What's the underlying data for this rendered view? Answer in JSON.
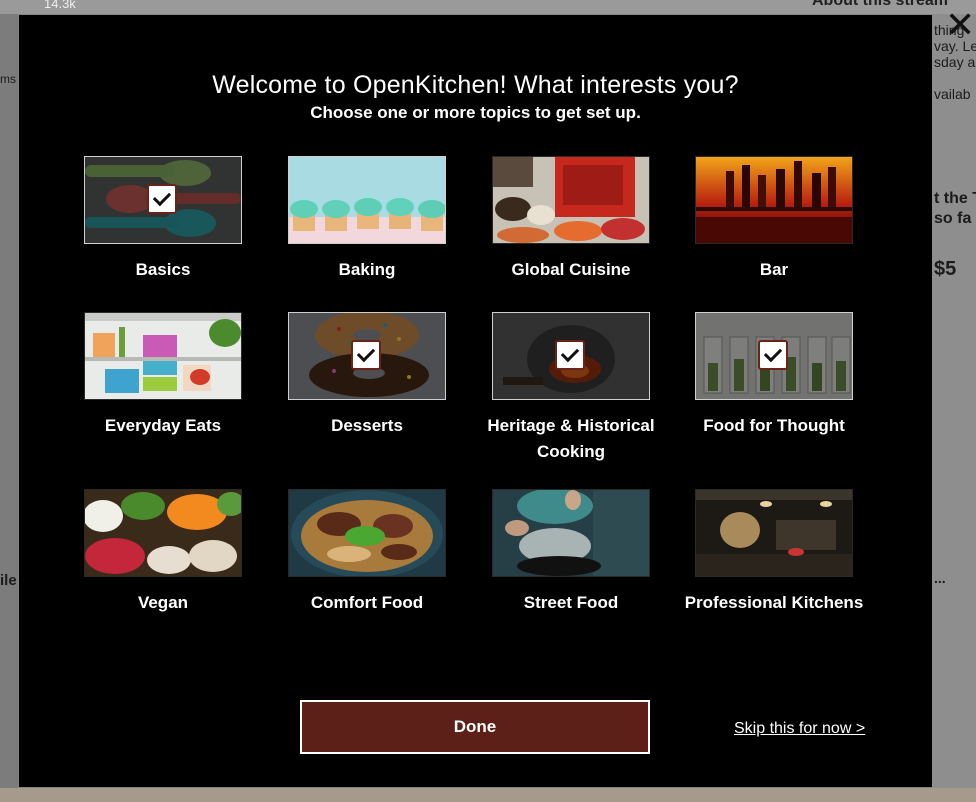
{
  "background": {
    "count": "14.3k",
    "heading": "About this stream",
    "lines": [
      "thing",
      "vay. Le",
      "sday a",
      "vailab",
      "t the T",
      "so fa",
      "$5",
      "ms",
      "ile",
      "..."
    ]
  },
  "close_icon": "close-icon",
  "modal": {
    "title": "Welcome to OpenKitchen! What interests you?",
    "subtitle": "Choose one or more topics to get set up.",
    "topics": [
      {
        "label": "Basics",
        "selected": true
      },
      {
        "label": "Baking",
        "selected": false
      },
      {
        "label": "Global Cuisine",
        "selected": false
      },
      {
        "label": "Bar",
        "selected": false
      },
      {
        "label": "Everyday Eats",
        "selected": false
      },
      {
        "label": "Desserts",
        "selected": true
      },
      {
        "label": "Heritage & Historical Cooking",
        "selected": true
      },
      {
        "label": "Food for Thought",
        "selected": true
      },
      {
        "label": "Vegan",
        "selected": false
      },
      {
        "label": "Comfort Food",
        "selected": false
      },
      {
        "label": "Street Food",
        "selected": false
      },
      {
        "label": "Professional Kitchens",
        "selected": false
      }
    ],
    "done_label": "Done",
    "skip_label": "Skip this for now >"
  },
  "colors": {
    "modal_bg": "#000000",
    "button_bg": "#5c2018",
    "check_border": "#6b2218"
  }
}
